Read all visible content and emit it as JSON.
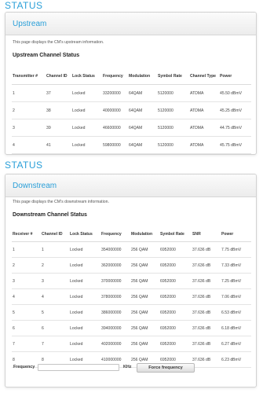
{
  "upstream": {
    "section_heading": "STATUS",
    "panel_title": "Upstream",
    "description": "This page displays the CM's upstream information.",
    "table_title": "Upstream Channel Status",
    "columns": [
      "Transmitter #",
      "Channel ID",
      "Lock Status",
      "Frequency",
      "Modulation",
      "Symbol Rate",
      "Channel Type",
      "Power"
    ],
    "rows": [
      [
        "1",
        "37",
        "Locked",
        "33200000",
        "64QAM",
        "5120000",
        "ATDMA",
        "45.50 dBmV"
      ],
      [
        "2",
        "38",
        "Locked",
        "40000000",
        "64QAM",
        "5120000",
        "ATDMA",
        "45.25 dBmV"
      ],
      [
        "3",
        "39",
        "Locked",
        "46600000",
        "64QAM",
        "5120000",
        "ATDMA",
        "44.75 dBmV"
      ],
      [
        "4",
        "41",
        "Locked",
        "59800000",
        "64QAM",
        "5120000",
        "ATDMA",
        "45.75 dBmV"
      ]
    ]
  },
  "downstream": {
    "section_heading": "STATUS",
    "panel_title": "Downstream",
    "description": "This page displays the CM's downstream information.",
    "table_title": "Downstream Channel Status",
    "columns": [
      "Receiver #",
      "Channel ID",
      "Lock Status",
      "Frequency",
      "Modulation",
      "Symbol Rate",
      "SNR",
      "Power"
    ],
    "rows": [
      [
        "1",
        "1",
        "Locked",
        "354000000",
        "256 QAM",
        "6952000",
        "37.636 dB",
        "7.75 dBmV"
      ],
      [
        "2",
        "2",
        "Locked",
        "362000000",
        "256 QAM",
        "6952000",
        "37.636 dB",
        "7.33 dBmV"
      ],
      [
        "3",
        "3",
        "Locked",
        "370000000",
        "256 QAM",
        "6952000",
        "37.636 dB",
        "7.25 dBmV"
      ],
      [
        "4",
        "4",
        "Locked",
        "378000000",
        "256 QAM",
        "6952000",
        "37.636 dB",
        "7.06 dBmV"
      ],
      [
        "5",
        "5",
        "Locked",
        "386000000",
        "256 QAM",
        "6952000",
        "37.636 dB",
        "6.53 dBmV"
      ],
      [
        "6",
        "6",
        "Locked",
        "394000000",
        "256 QAM",
        "6952000",
        "37.636 dB",
        "6.18 dBmV"
      ],
      [
        "7",
        "7",
        "Locked",
        "402000000",
        "256 QAM",
        "6952000",
        "37.636 dB",
        "6.27 dBmV"
      ],
      [
        "8",
        "8",
        "Locked",
        "410000000",
        "256 QAM",
        "6952000",
        "37.636 dB",
        "6.23 dBmV"
      ]
    ]
  },
  "force_frequency": {
    "label": "Frequency",
    "value": "",
    "unit": "KHz",
    "button_label": "Force frequency"
  },
  "colors": {
    "accent": "#2a9fd8",
    "panel_border": "#d2d2d2"
  }
}
